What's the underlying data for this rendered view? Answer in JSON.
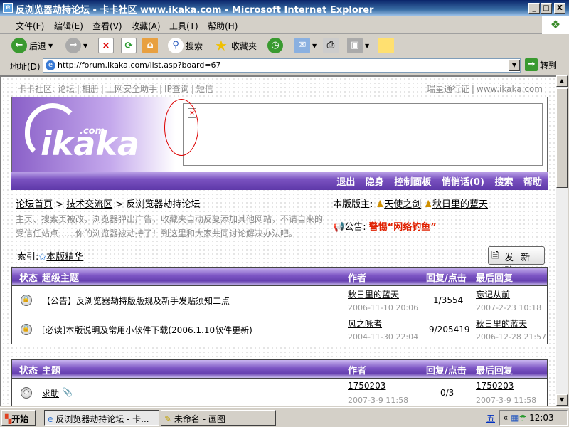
{
  "window": {
    "title": "反浏览器劫持论坛 - 卡卡社区 www.ikaka.com - Microsoft Internet Explorer",
    "min": "_",
    "max": "□",
    "close": "X"
  },
  "menu": [
    "文件(F)",
    "编辑(E)",
    "查看(V)",
    "收藏(A)",
    "工具(T)",
    "帮助(H)"
  ],
  "toolbar": {
    "back": "后退",
    "search": "搜索",
    "favorites": "收藏夹"
  },
  "address": {
    "label": "地址(D)",
    "url": "http://forum.ikaka.com/list.asp?board=67",
    "go": "转到"
  },
  "toplinks": {
    "left": [
      "卡卡社区: 论坛",
      "相册",
      "上网安全助手",
      "IP查询",
      "短信"
    ],
    "right": [
      "瑞星通行证",
      "www.ikaka.com"
    ]
  },
  "logo": {
    "brand": "ikaka",
    ".com": ".com"
  },
  "nav": [
    "退出",
    "隐身",
    "控制面板",
    "悄悄话(0)",
    "搜索",
    "帮助"
  ],
  "breadcrumb": [
    "论坛首页",
    "技术交流区",
    "反浏览器劫持论坛"
  ],
  "description": "主页、搜索页被改，浏览器弹出广告，收藏夹自动反复添加其他网站，不请自来的受信任站点……你的浏览器被劫持了！到这里和大家共同讨论解决办法吧。",
  "moderators": {
    "label": "本版版主:",
    "names": [
      "天使之剑",
      "秋日里的蓝天"
    ]
  },
  "notice": {
    "label": "公告:",
    "text": "警惕“网络钓鱼”"
  },
  "index": {
    "label": "索引:",
    "link": "本版精华"
  },
  "new_post": "发 新 贴",
  "table1": {
    "headers": [
      "状态",
      "超级主题",
      "作者",
      "回复/点击",
      "最后回复"
    ],
    "rows": [
      {
        "title": "【公告】反浏览器劫持版版规及新手发贴须知二点",
        "author": "秋日里的蓝天",
        "date": "2006-11-10 20:06",
        "stats": "1/3554",
        "last_user": "忘记从前",
        "last_date": "2007-2-23 10:18"
      },
      {
        "title": "[必读]本版说明及常用小软件下载(2006.1.10软件更新)",
        "author": "风之咏者",
        "date": "2004-11-30 22:04",
        "stats": "9/205419",
        "last_user": "秋日里的蓝天",
        "last_date": "2006-12-28 21:57"
      }
    ]
  },
  "table2": {
    "headers": [
      "状态",
      "主题",
      "作者",
      "回复/点击",
      "最后回复"
    ],
    "rows": [
      {
        "title": "求助",
        "author": "1750203",
        "date": "2007-3-9 11:58",
        "stats": "0/3",
        "last_user": "1750203",
        "last_date": "2007-3-9 11:58"
      }
    ]
  },
  "taskbar": {
    "start": "开始",
    "tasks": [
      "反浏览器劫持论坛 - 卡...",
      "未命名 - 画图"
    ],
    "ime": "五",
    "time": "12:03"
  }
}
